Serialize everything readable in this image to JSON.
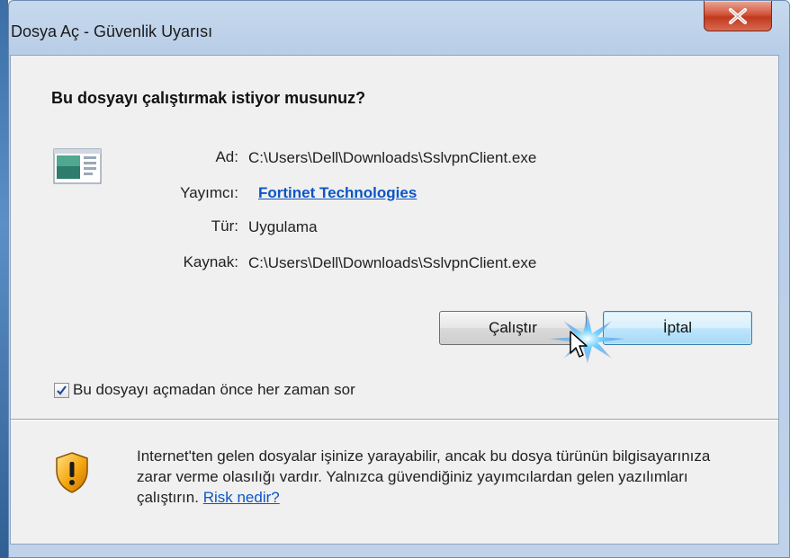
{
  "window": {
    "title": "Dosya Aç - Güvenlik Uyarısı",
    "close_glyph": "X"
  },
  "dialog": {
    "question": "Bu dosyayı çalıştırmak istiyor musunuz?",
    "app_icon": "application-window-icon",
    "details": {
      "name_label": "Ad:",
      "name_value": "C:\\Users\\Dell\\Downloads\\SslvpnClient.exe",
      "publisher_label": "Yayımcı:",
      "publisher_value": "Fortinet Technologies",
      "type_label": "Tür:",
      "type_value": "Uygulama",
      "source_label": "Kaynak:",
      "source_value": "C:\\Users\\Dell\\Downloads\\SslvpnClient.exe"
    },
    "buttons": {
      "run_label": "Çalıştır",
      "cancel_label": "İptal"
    },
    "checkbox": {
      "label": "Bu dosyayı açmadan önce her zaman sor",
      "checked": true
    },
    "warning": {
      "icon": "shield-warning-icon",
      "text": "Internet'ten gelen dosyalar işinize yarayabilir, ancak bu dosya türünün bilgisayarınıza zarar verme olasılığı vardır. Yalnızca güvendiğiniz yayımcılardan gelen yazılımları çalıştırın.",
      "link": "Risk nedir?"
    }
  },
  "colors": {
    "link": "#0b56c5",
    "default_button_border": "#3c7fb1",
    "close_button": "#c0391e"
  }
}
